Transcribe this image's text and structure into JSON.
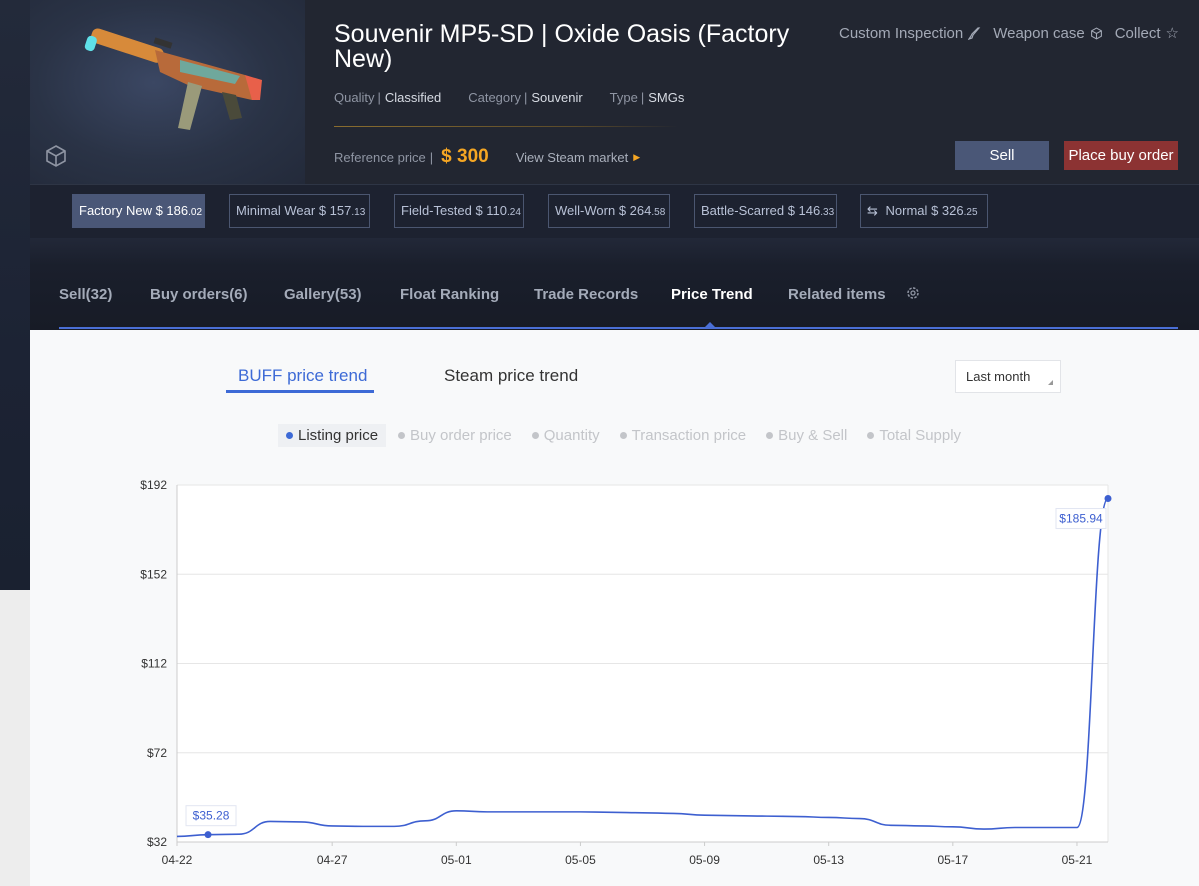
{
  "item": {
    "title": "Souvenir MP5-SD | Oxide Oasis (Factory New)",
    "quality_label": "Quality",
    "quality": "Classified",
    "category_label": "Category",
    "category": "Souvenir",
    "type_label": "Type",
    "type": "SMGs",
    "reference_label": "Reference price",
    "reference_price": "$ 300",
    "steam_link": "View Steam market"
  },
  "top_actions": {
    "custom_inspection": "Custom Inspection",
    "weapon_case": "Weapon case",
    "collect": "Collect"
  },
  "buttons": {
    "sell": "Sell",
    "buy_order": "Place buy order"
  },
  "wears": [
    {
      "name": "Factory New",
      "price_main": "$ 186",
      "price_dec": ".02",
      "active": true
    },
    {
      "name": "Minimal Wear",
      "price_main": "$ 157",
      "price_dec": ".13"
    },
    {
      "name": "Field-Tested",
      "price_main": "$ 110",
      "price_dec": ".24"
    },
    {
      "name": "Well-Worn",
      "price_main": "$ 264",
      "price_dec": ".58"
    },
    {
      "name": "Battle-Scarred",
      "price_main": "$ 146",
      "price_dec": ".33"
    },
    {
      "name": "Normal",
      "price_main": "$ 326",
      "price_dec": ".25"
    }
  ],
  "tabs": [
    {
      "label": "Sell(32)"
    },
    {
      "label": "Buy orders(6)"
    },
    {
      "label": "Gallery(53)"
    },
    {
      "label": "Float Ranking"
    },
    {
      "label": "Trade Records"
    },
    {
      "label": "Price Trend",
      "active": true
    },
    {
      "label": "Related items"
    }
  ],
  "subtabs": {
    "buff": "BUFF price trend",
    "steam": "Steam price trend"
  },
  "range_select": "Last month",
  "legend": [
    "Listing price",
    "Buy order price",
    "Quantity",
    "Transaction price",
    "Buy & Sell",
    "Total Supply"
  ],
  "colors": {
    "accent": "#3d6ad6",
    "gold": "#f5a623",
    "buy_button": "#8c3333",
    "sell_button": "#4a5777"
  },
  "chart_data": {
    "type": "line",
    "series": [
      {
        "name": "Listing price",
        "x": [
          "04-22",
          "04-23",
          "04-24",
          "04-25",
          "04-26",
          "04-27",
          "04-28",
          "04-29",
          "04-30",
          "05-01",
          "05-02",
          "05-03",
          "05-04",
          "05-05",
          "05-06",
          "05-07",
          "05-08",
          "05-09",
          "05-10",
          "05-11",
          "05-12",
          "05-13",
          "05-14",
          "05-15",
          "05-16",
          "05-17",
          "05-18",
          "05-19",
          "05-20",
          "05-21",
          "05-22"
        ],
        "values": [
          34.5,
          35.28,
          35.5,
          41.2,
          41.0,
          39.2,
          39.0,
          39.0,
          41.5,
          46.0,
          45.5,
          45.5,
          45.5,
          45.5,
          45.3,
          45.1,
          44.8,
          44.0,
          43.8,
          43.6,
          43.4,
          43.0,
          42.5,
          39.5,
          39.2,
          38.8,
          37.8,
          38.5,
          38.5,
          38.5,
          185.94
        ]
      }
    ],
    "annotations": [
      {
        "x": "04-23",
        "label": "$35.28"
      },
      {
        "x": "05-22",
        "label": "$185.94"
      }
    ],
    "x_ticks": [
      "04-22",
      "04-27",
      "05-01",
      "05-05",
      "05-09",
      "05-13",
      "05-17",
      "05-21"
    ],
    "y_ticks": [
      "$32",
      "$72",
      "$112",
      "$152",
      "$192"
    ],
    "ylim": [
      32,
      192
    ],
    "grid": true
  }
}
